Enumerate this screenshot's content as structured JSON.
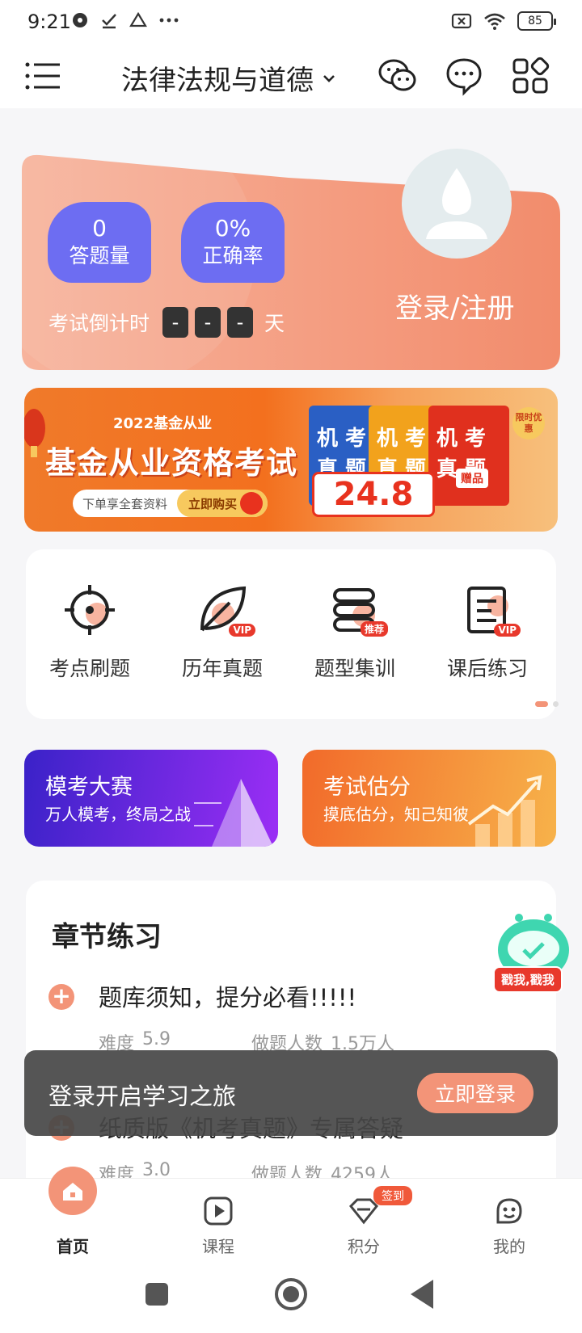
{
  "status_bar": {
    "time": "9:21",
    "battery": "85"
  },
  "header": {
    "subject": "法律法规与道德"
  },
  "profile": {
    "questions_value": "0",
    "questions_label": "答题量",
    "accuracy_value": "0%",
    "accuracy_label": "正确率",
    "countdown_label": "考试倒计时",
    "countdown_digits": [
      "-",
      "-",
      "-"
    ],
    "countdown_unit": "天",
    "login_text": "登录/注册"
  },
  "banner": {
    "year_text": "2022基金从业",
    "title": "基金从业资格考试",
    "cta_left": "下单享全套资料",
    "cta_right": "立即购买",
    "book_text": [
      "机 考",
      "真 题"
    ],
    "price": "24.8",
    "promo": "限时优惠",
    "gift": "赠品"
  },
  "features": [
    {
      "label": "考点刷题",
      "tag": ""
    },
    {
      "label": "历年真题",
      "tag": "VIP"
    },
    {
      "label": "题型集训",
      "tag": "推荐"
    },
    {
      "label": "课后练习",
      "tag": "VIP"
    }
  ],
  "promos": [
    {
      "title": "模考大赛",
      "subtitle": "万人模考，终局之战",
      "color_from": "#3a22c8",
      "color_to": "#9b2ef5"
    },
    {
      "title": "考试估分",
      "subtitle": "摸底估分，知己知彼",
      "color_from": "#f26a2a",
      "color_to": "#f7b24a"
    }
  ],
  "chapter": {
    "heading": "章节练习",
    "items": [
      {
        "title": "题库须知，提分必看!!!!!",
        "difficulty_label": "难度",
        "difficulty": "5.9",
        "count_label": "做题人数",
        "count": "1.5万人"
      },
      {
        "title": "纸质版《机考真题》专属答疑",
        "difficulty_label": "难度",
        "difficulty": "3.0",
        "count_label": "做题人数",
        "count": "4259人"
      }
    ]
  },
  "mascot_tag": "戳我,戳我",
  "toast": {
    "text": "登录开启学习之旅",
    "button": "立即登录"
  },
  "tabs": [
    {
      "label": "首页",
      "icon": "home-icon"
    },
    {
      "label": "课程",
      "icon": "play-icon"
    },
    {
      "label": "积分",
      "icon": "diamond-icon",
      "badge": "签到"
    },
    {
      "label": "我的",
      "icon": "face-icon"
    }
  ],
  "colors": {
    "accent": "#f39478",
    "stat_pill": "#6d6df2",
    "card_bg": "#f5a389"
  }
}
